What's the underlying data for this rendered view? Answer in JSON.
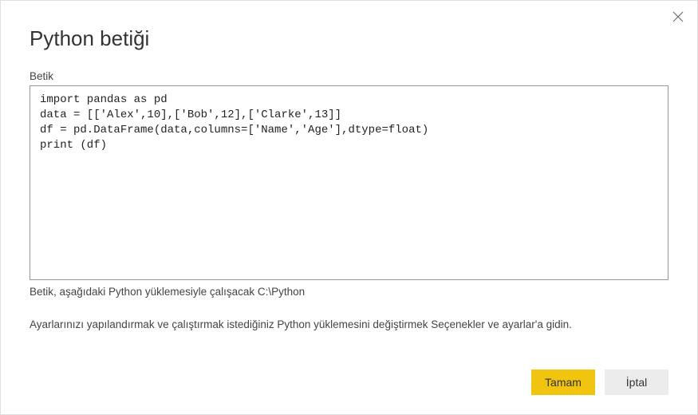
{
  "title": "Python betiği",
  "field_label": "Betik",
  "script": "import pandas as pd\ndata = [['Alex',10],['Bob',12],['Clarke',13]]\ndf = pd.DataFrame(data,columns=['Name','Age'],dtype=float)\nprint (df)",
  "info_text": "Betik, aşağıdaki Python yüklemesiyle çalışacak C:\\Python",
  "settings_text": "Ayarlarınızı yapılandırmak ve çalıştırmak istediğiniz Python yüklemesini değiştirmek Seçenekler ve ayarlar'a gidin.",
  "buttons": {
    "ok": "Tamam",
    "cancel": "İptal"
  }
}
